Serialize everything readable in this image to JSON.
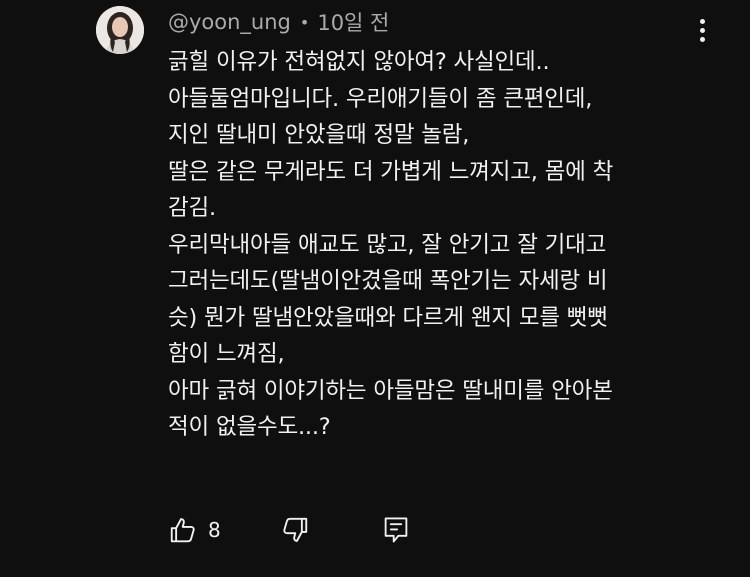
{
  "comment": {
    "author": "@yoon_ung",
    "separator": "•",
    "time": "10일 전",
    "lines": [
      "긁힐 이유가 전혀없지 않아여? 사실인데..",
      "아들둘엄마입니다. 우리애기들이 좀 큰편인데,",
      "지인 딸내미 안았을때 정말 놀람,",
      "딸은 같은 무게라도 더 가볍게 느껴지고, 몸에 착",
      "감김.",
      "우리막내아들 애교도 많고, 잘 안기고 잘 기대고",
      "그러는데도(딸냄이안겼을때 폭안기는 자세랑 비",
      "슷) 뭔가 딸냄안았을때와 다르게 왠지 모를 뻣뻣",
      "함이 느껴짐,",
      "아마 긁혀 이야기하는 아들맘은 딸내미를 안아본",
      "적이 없을수도...?"
    ],
    "like_count": "8"
  },
  "icons": {
    "more": "more-vertical-icon",
    "like": "thumb-up-icon",
    "dislike": "thumb-down-icon",
    "reply": "reply-icon"
  }
}
